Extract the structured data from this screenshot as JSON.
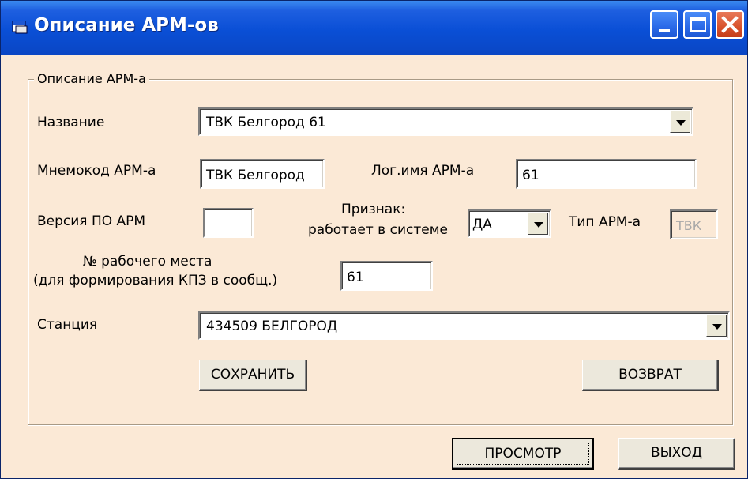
{
  "window": {
    "title": "Описание АРМ-ов",
    "icon": "window-app-icon",
    "controls": [
      "minimize-icon",
      "maximize-icon",
      "close-icon"
    ]
  },
  "group": {
    "legend": "Описание АРМ-а"
  },
  "form": {
    "name_label": "Название",
    "name_value": "ТВК Белгород 61",
    "mnemo_label": "Мнемокод АРМ-а",
    "mnemo_value": "ТВК Белгород",
    "logname_label": "Лог.имя АРМ-а",
    "logname_value": "61",
    "version_label": "Версия ПО АРМ",
    "version_value": "",
    "flag_label_line1": "Признак:",
    "flag_label_line2": "работает в системе",
    "flag_value": "ДА",
    "type_label": "Тип АРМ-а",
    "type_value": "ТВК",
    "workplace_label_line1": "№ рабочего места",
    "workplace_label_line2": "(для формирования КПЗ в сообщ.)",
    "workplace_value": "61",
    "station_label": "Станция",
    "station_value": "434509  БЕЛГОРОД"
  },
  "buttons": {
    "save": "СОХРАНИТЬ",
    "back": "ВОЗВРАТ",
    "view": "ПРОСМОТР",
    "exit": "ВЫХОД"
  },
  "colors": {
    "titlebar": "#0a4fd6",
    "window_bg": "#fbe9d6",
    "close_button": "#d8522c"
  }
}
